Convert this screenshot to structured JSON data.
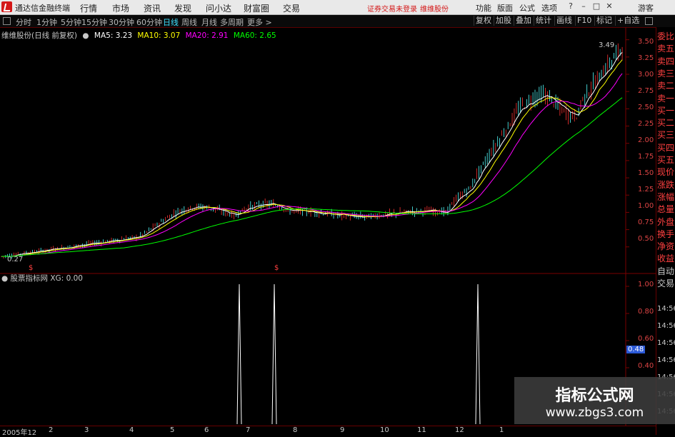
{
  "app": {
    "title": "通达信金融终端",
    "menu": [
      "行情",
      "市场",
      "资讯",
      "发现",
      "问小达",
      "财富圈",
      "交易"
    ],
    "broker_warning": "证券交易未登录",
    "stock_link": "维维股份",
    "right_menu": [
      "功能",
      "版面",
      "公式",
      "选项"
    ],
    "guest": "游客"
  },
  "periods": {
    "items": [
      "分时",
      "1分钟",
      "5分钟",
      "15分钟",
      "30分钟",
      "60分钟",
      "日线",
      "周线",
      "月线",
      "多周期",
      "更多 >"
    ],
    "active": "日线"
  },
  "toolbar_right": [
    "复权",
    "加股",
    "叠加",
    "统计",
    "画线",
    "F10",
    "标记",
    "+自选"
  ],
  "main_chart": {
    "stock_title": "维维股份(日线 前复权)",
    "ma": [
      {
        "label": "MA5: 3.23",
        "color": "#ffffff"
      },
      {
        "label": "MA10: 3.07",
        "color": "#ffff00"
      },
      {
        "label": "MA20: 2.91",
        "color": "#ff00ff"
      },
      {
        "label": "MA60: 2.65",
        "color": "#00ff00"
      }
    ],
    "high_marker": "3.49",
    "low_marker": "0.27",
    "price_axis": [
      "3.50",
      "3.25",
      "3.00",
      "2.75",
      "2.50",
      "2.25",
      "2.00",
      "1.75",
      "1.50",
      "1.25",
      "1.00",
      "0.75",
      "0.50"
    ],
    "signal_mark": "$"
  },
  "sub_chart": {
    "title": "股票指标网",
    "value_label": "XG: 0.00",
    "axis": [
      "1.00",
      "0.80",
      "0.60",
      "0.48",
      "0.40"
    ],
    "current_value": "0.48"
  },
  "right_panel": {
    "labels": [
      "委比",
      "卖五",
      "卖四",
      "卖三",
      "卖二",
      "卖一",
      "买一",
      "买二",
      "买三",
      "买四",
      "买五",
      "现价",
      "涨跌",
      "涨幅",
      "总量",
      "外盘",
      "换手",
      "净资",
      "收益",
      "自动",
      "交易"
    ],
    "times": [
      "14:56",
      "14:56",
      "14:56",
      "14:56",
      "14:56",
      "14:56",
      "14:56"
    ]
  },
  "date_axis": [
    "2005年12",
    "2",
    "3",
    "4",
    "5",
    "6",
    "7",
    "8",
    "9",
    "10",
    "11",
    "12",
    "1"
  ],
  "watermark": {
    "line1": "指标公式网",
    "line2": "www.zbgs3.com"
  },
  "colors": {
    "up": "#ff3232",
    "down": "#54ffff",
    "axis": "#7a0000",
    "ma5": "#ffffff",
    "ma10": "#ffff00",
    "ma20": "#ff00ff",
    "ma60": "#00ff00"
  },
  "chart_data": {
    "type": "line",
    "title": "维维股份(日线 前复权)",
    "ylim": [
      0.27,
      3.6
    ],
    "series": [
      {
        "name": "MA5",
        "last": 3.23
      },
      {
        "name": "MA10",
        "last": 3.07
      },
      {
        "name": "MA20",
        "last": 2.91
      },
      {
        "name": "MA60",
        "last": 2.65
      }
    ],
    "xg_signals": [
      1,
      1,
      1
    ],
    "xg_ylim": [
      0,
      1.0
    ]
  }
}
